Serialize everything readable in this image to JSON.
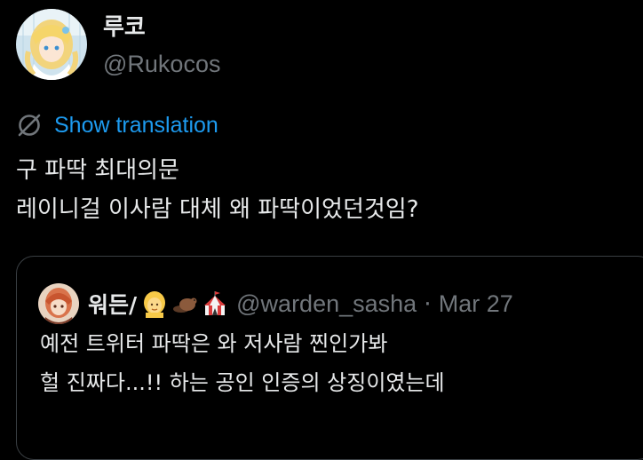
{
  "author": {
    "display_name": "루코",
    "handle": "@Rukocos"
  },
  "translation": {
    "label": "Show translation",
    "icon": "globe-slash-icon"
  },
  "tweet": {
    "text": "구 파딱 최대의문\n레이니걸 이사람 대체 왜 파딱이었던것임?"
  },
  "quoted": {
    "display_name": "워든/",
    "emojis": [
      "blonde-person-emoji",
      "beaver-emoji",
      "circus-tent-emoji"
    ],
    "handle": "@warden_sasha",
    "separator": "·",
    "date": "Mar 27",
    "text": "예전 트위터 파딱은 와 저사람 찐인가봐\n헐 진짜다...!! 하는 공인 인증의 상징이였는데"
  },
  "colors": {
    "background": "#000000",
    "text": "#e7e9ea",
    "secondary": "#71767b",
    "link": "#1d9bf0",
    "border": "#3a3f43"
  }
}
